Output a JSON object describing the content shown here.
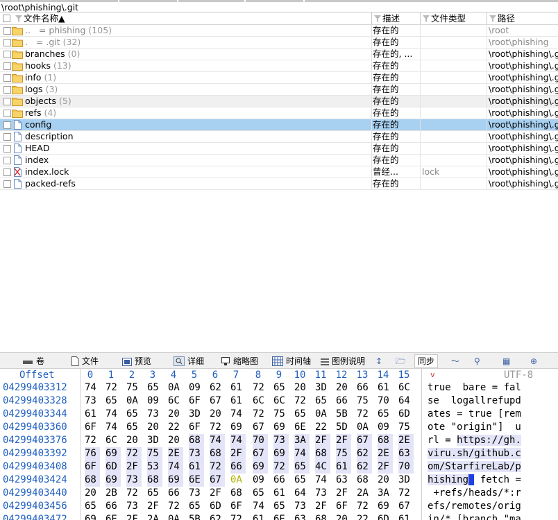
{
  "path": "\\root\\phishing\\.git",
  "columns": {
    "name": "文件名称",
    "desc": "描述",
    "type": "文件类型",
    "path": "路径"
  },
  "files": [
    {
      "icon": "folder-icon",
      "name": "..",
      "extra": "=    phishing",
      "count": "(105)",
      "desc": "存在的",
      "type": "",
      "path": "\\root",
      "gray": true
    },
    {
      "icon": "folder-icon",
      "name": ".",
      "extra": "=    .git",
      "count": "(32)",
      "desc": "存在的",
      "type": "",
      "path": "\\root\\phishing",
      "gray": true
    },
    {
      "icon": "folder-icon",
      "name": "branches",
      "extra": "",
      "count": "(0)",
      "desc": "存在的, ...",
      "type": "",
      "path": "\\root\\phishing\\.gi"
    },
    {
      "icon": "folder-icon",
      "name": "hooks",
      "extra": "",
      "count": "(13)",
      "desc": "存在的",
      "type": "",
      "path": "\\root\\phishing\\.gi"
    },
    {
      "icon": "folder-icon",
      "name": "info",
      "extra": "",
      "count": "(1)",
      "desc": "存在的",
      "type": "",
      "path": "\\root\\phishing\\.gi"
    },
    {
      "icon": "folder-icon",
      "name": "logs",
      "extra": "",
      "count": "(3)",
      "desc": "存在的",
      "type": "",
      "path": "\\root\\phishing\\.gi"
    },
    {
      "icon": "folder-icon",
      "name": "objects",
      "extra": "",
      "count": "(5)",
      "desc": "存在的",
      "type": "",
      "path": "\\root\\phishing\\.gi",
      "shade": true
    },
    {
      "icon": "folder-icon",
      "name": "refs",
      "extra": "",
      "count": "(4)",
      "desc": "存在的",
      "type": "",
      "path": "\\root\\phishing\\.gi"
    },
    {
      "icon": "file-icon",
      "name": "config",
      "extra": "",
      "count": "",
      "desc": "存在的",
      "type": "",
      "path": "\\root\\phishing\\.gi",
      "selected": true
    },
    {
      "icon": "file-icon",
      "name": "description",
      "extra": "",
      "count": "",
      "desc": "存在的",
      "type": "",
      "path": "\\root\\phishing\\.gi"
    },
    {
      "icon": "file-icon",
      "name": "HEAD",
      "extra": "",
      "count": "",
      "desc": "存在的",
      "type": "",
      "path": "\\root\\phishing\\.gi"
    },
    {
      "icon": "file-icon",
      "name": "index",
      "extra": "",
      "count": "",
      "desc": "存在的",
      "type": "",
      "path": "\\root\\phishing\\.gi"
    },
    {
      "icon": "deleted-file-icon",
      "name": "index.lock",
      "extra": "",
      "count": "",
      "desc": "曾经...",
      "type": "lock",
      "path": "\\root\\phishing\\.gi"
    },
    {
      "icon": "file-icon",
      "name": "packed-refs",
      "extra": "",
      "count": "",
      "desc": "存在的",
      "type": "",
      "path": "\\root\\phishing\\.gi"
    }
  ],
  "toolbar": [
    {
      "name": "volume",
      "label": "卷",
      "icon": "drive-icon"
    },
    {
      "name": "file",
      "label": "文件",
      "icon": "document-icon"
    },
    {
      "name": "preview",
      "label": "预览",
      "icon": "preview-icon"
    },
    {
      "name": "details",
      "label": "详细",
      "icon": "magnifier-icon"
    },
    {
      "name": "thumbnails",
      "label": "缩略图",
      "icon": "monitor-icon"
    },
    {
      "name": "timeline",
      "label": "时间轴",
      "icon": "calendar-icon"
    },
    {
      "name": "legend",
      "label": "图例说明",
      "icon": "list-icon"
    },
    {
      "name": "sync",
      "label": "同步",
      "icon": "sync-icon",
      "active": true
    }
  ],
  "hex": {
    "offset_label": "Offset",
    "columns": [
      "0",
      "1",
      "2",
      "3",
      "4",
      "5",
      "6",
      "7",
      "8",
      "9",
      "10",
      "11",
      "12",
      "13",
      "14",
      "15"
    ],
    "encoding": "UTF-8",
    "rows": [
      {
        "addr": "04299403312",
        "bytes": [
          "74",
          "72",
          "75",
          "65",
          "0A",
          "09",
          "62",
          "61",
          "72",
          "65",
          "20",
          "3D",
          "20",
          "66",
          "61",
          "6C"
        ],
        "text": "true  bare = fal"
      },
      {
        "addr": "04299403328",
        "bytes": [
          "73",
          "65",
          "0A",
          "09",
          "6C",
          "6F",
          "67",
          "61",
          "6C",
          "6C",
          "72",
          "65",
          "66",
          "75",
          "70",
          "64"
        ],
        "text": "se  logallrefupd"
      },
      {
        "addr": "04299403344",
        "bytes": [
          "61",
          "74",
          "65",
          "73",
          "20",
          "3D",
          "20",
          "74",
          "72",
          "75",
          "65",
          "0A",
          "5B",
          "72",
          "65",
          "6D"
        ],
        "text": "ates = true [rem"
      },
      {
        "addr": "04299403360",
        "bytes": [
          "6F",
          "74",
          "65",
          "20",
          "22",
          "6F",
          "72",
          "69",
          "67",
          "69",
          "6E",
          "22",
          "5D",
          "0A",
          "09",
          "75"
        ],
        "text": "ote \"origin\"]  u"
      },
      {
        "addr": "04299403376",
        "bytes": [
          "72",
          "6C",
          "20",
          "3D",
          "20",
          "68",
          "74",
          "74",
          "70",
          "73",
          "3A",
          "2F",
          "2F",
          "67",
          "68",
          "2E"
        ],
        "text": "rl = https://gh.",
        "hl_from": 5
      },
      {
        "addr": "04299403392",
        "bytes": [
          "76",
          "69",
          "72",
          "75",
          "2E",
          "73",
          "68",
          "2F",
          "67",
          "69",
          "74",
          "68",
          "75",
          "62",
          "2E",
          "63"
        ],
        "text": "viru.sh/github.c",
        "hl_from": 0
      },
      {
        "addr": "04299403408",
        "bytes": [
          "6F",
          "6D",
          "2F",
          "53",
          "74",
          "61",
          "72",
          "66",
          "69",
          "72",
          "65",
          "4C",
          "61",
          "62",
          "2F",
          "70"
        ],
        "text": "om/StarfireLab/p",
        "hl_from": 0
      },
      {
        "addr": "04299403424",
        "bytes": [
          "68",
          "69",
          "73",
          "68",
          "69",
          "6E",
          "67",
          "0A",
          "09",
          "66",
          "65",
          "74",
          "63",
          "68",
          "20",
          "3D"
        ],
        "text": "hishing  fetch =",
        "hl_to": 7
      },
      {
        "addr": "04299403440",
        "bytes": [
          "20",
          "2B",
          "72",
          "65",
          "66",
          "73",
          "2F",
          "68",
          "65",
          "61",
          "64",
          "73",
          "2F",
          "2A",
          "3A",
          "72"
        ],
        "text": " +refs/heads/*:r"
      },
      {
        "addr": "04299403456",
        "bytes": [
          "65",
          "66",
          "73",
          "2F",
          "72",
          "65",
          "6D",
          "6F",
          "74",
          "65",
          "73",
          "2F",
          "6F",
          "72",
          "69",
          "67"
        ],
        "text": "efs/remotes/orig"
      },
      {
        "addr": "04299403472",
        "bytes": [
          "69",
          "6E",
          "2F",
          "2A",
          "0A",
          "5B",
          "62",
          "72",
          "61",
          "6E",
          "63",
          "68",
          "20",
          "22",
          "6D",
          "61"
        ],
        "text": "in/* [branch \"ma"
      }
    ]
  }
}
